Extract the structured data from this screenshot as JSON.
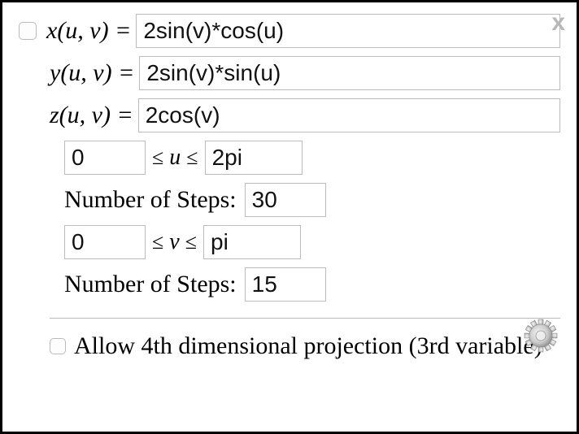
{
  "close_label": "x",
  "eq": {
    "x_label": "x(u, v) = ",
    "y_label": "y(u, v) = ",
    "z_label": "z(u, v) = ",
    "x_value": "2sin(v)*cos(u)",
    "y_value": "2sin(v)*sin(u)",
    "z_value": "2cos(v)"
  },
  "u_range": {
    "min": "0",
    "mid_label": "≤ u ≤",
    "max": "2pi",
    "steps_label": "Number of Steps:",
    "steps_value": "30"
  },
  "v_range": {
    "min": "0",
    "mid_label": "≤ v ≤",
    "max": "pi",
    "steps_label": "Number of Steps:",
    "steps_value": "15"
  },
  "fourth_dim": {
    "label": "Allow 4th dimensional projection (3rd variable)"
  }
}
